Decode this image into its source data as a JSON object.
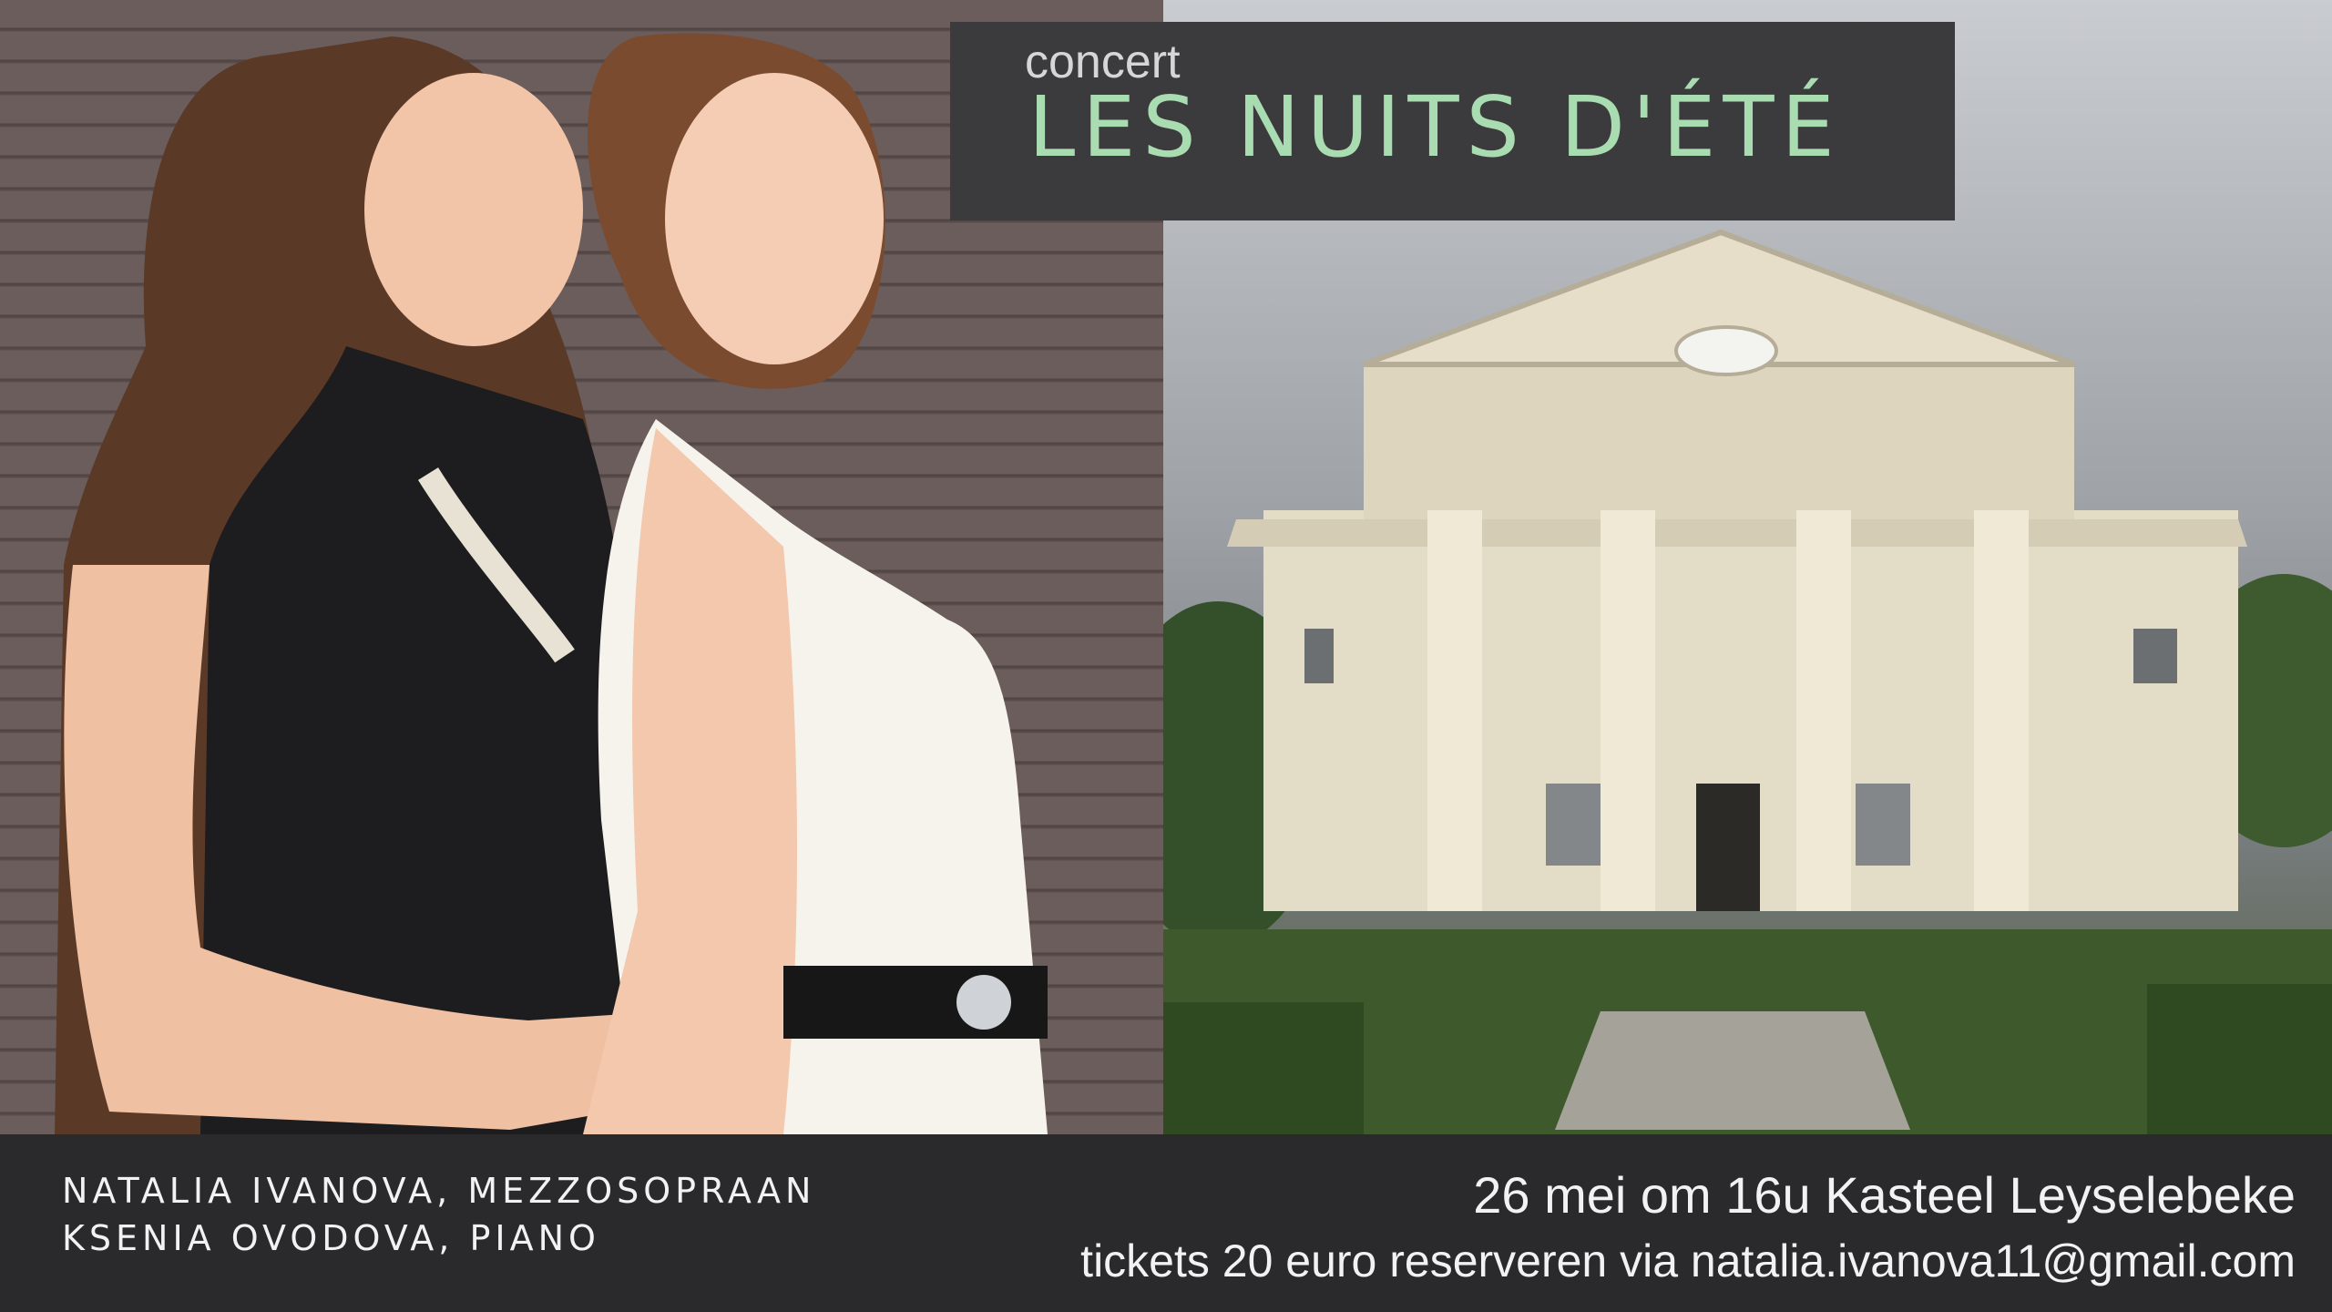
{
  "title": {
    "small": "concert",
    "main": "LES NUITS D'ÉTÉ"
  },
  "performers": [
    "NATALIA IVANOVA, MEZZOSOPRAAN",
    "KSENIA OVODOVA, PIANO"
  ],
  "event": {
    "date_location": "26 mei om 16u Kasteel Leyselebeke",
    "tickets": "tickets 20 euro reserveren via natalia.ivanova11@gmail.com"
  },
  "colors": {
    "title_accent": "#a9dcb1",
    "banner_bg": "#3b3a3c",
    "bar_bg": "#2a292b",
    "text_light": "#f2f2f2"
  },
  "images": {
    "left": "photo-two-women",
    "right": "photo-villa"
  }
}
